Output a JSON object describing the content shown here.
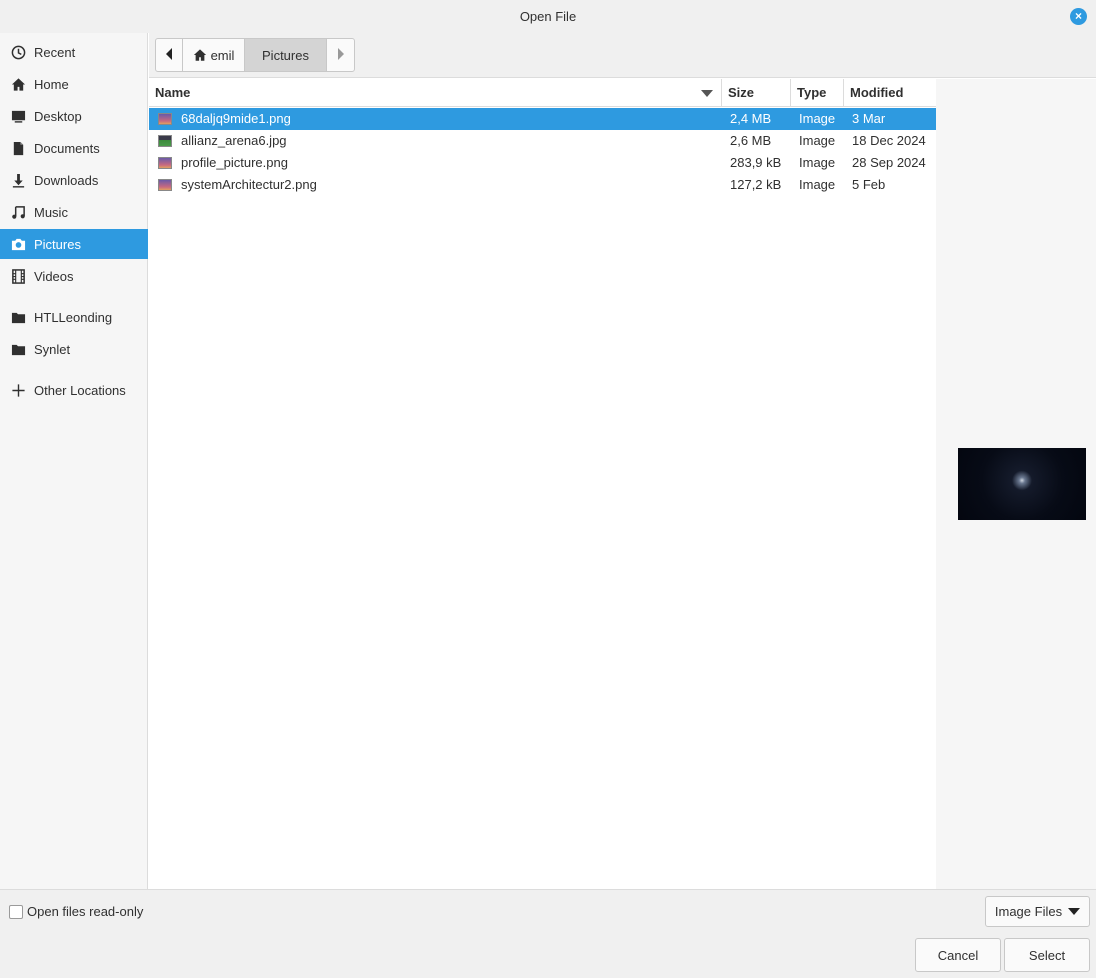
{
  "window": {
    "title": "Open File",
    "close_label": "×"
  },
  "sidebar": {
    "items": [
      {
        "label": "Recent",
        "icon": "clock-icon"
      },
      {
        "label": "Home",
        "icon": "home-icon"
      },
      {
        "label": "Desktop",
        "icon": "monitor-icon"
      },
      {
        "label": "Documents",
        "icon": "document-icon"
      },
      {
        "label": "Downloads",
        "icon": "download-icon"
      },
      {
        "label": "Music",
        "icon": "music-note-icon"
      },
      {
        "label": "Pictures",
        "icon": "camera-icon",
        "active": true
      },
      {
        "label": "Videos",
        "icon": "film-icon"
      }
    ],
    "bookmarks": [
      {
        "label": "HTLLeonding",
        "icon": "folder-icon"
      },
      {
        "label": "Synlet",
        "icon": "folder-icon"
      }
    ],
    "other_locations": {
      "label": "Other Locations",
      "icon": "plus-icon"
    }
  },
  "pathbar": {
    "home_label": "emil",
    "current_label": "Pictures"
  },
  "columns": {
    "name": "Name",
    "size": "Size",
    "type": "Type",
    "modified": "Modified"
  },
  "files": [
    {
      "name": "68daljq9mide1.png",
      "size": "2,4 MB",
      "type": "Image",
      "modified": "3 Mar",
      "selected": true
    },
    {
      "name": "allianz_arena6.jpg",
      "size": "2,6 MB",
      "type": "Image",
      "modified": "18 Dec 2024"
    },
    {
      "name": "profile_picture.png",
      "size": "283,9 kB",
      "type": "Image",
      "modified": "28 Sep 2024"
    },
    {
      "name": "systemArchitectur2.png",
      "size": "127,2 kB",
      "type": "Image",
      "modified": "5 Feb"
    }
  ],
  "bottom": {
    "readonly_label": "Open files read-only",
    "filter_label": "Image Files",
    "cancel_label": "Cancel",
    "select_label": "Select"
  },
  "colors": {
    "accent": "#2e9ae0",
    "sidebar_bg": "#f6f6f6",
    "chrome_bg": "#f0f0f0"
  }
}
